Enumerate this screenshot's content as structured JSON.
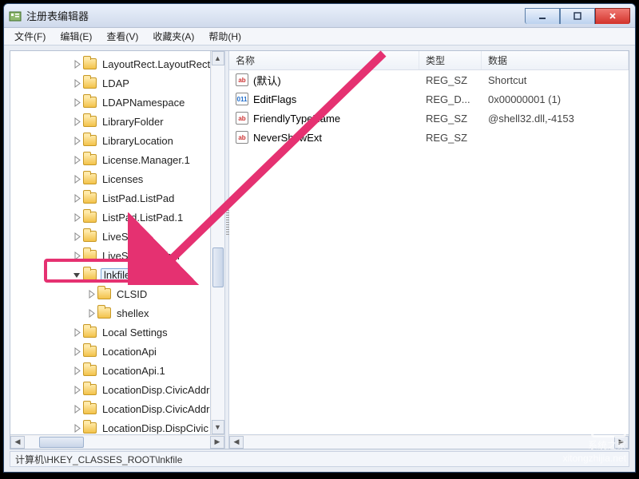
{
  "window": {
    "title": "注册表编辑器"
  },
  "menubar": {
    "items": [
      "文件(F)",
      "编辑(E)",
      "查看(V)",
      "收藏夹(A)",
      "帮助(H)"
    ]
  },
  "tree": {
    "nodes": [
      {
        "indent": 3,
        "expander": "▷",
        "label": "LayoutRect.LayoutRect"
      },
      {
        "indent": 3,
        "expander": "▷",
        "label": "LDAP"
      },
      {
        "indent": 3,
        "expander": "▷",
        "label": "LDAPNamespace"
      },
      {
        "indent": 3,
        "expander": "▷",
        "label": "LibraryFolder"
      },
      {
        "indent": 3,
        "expander": "▷",
        "label": "LibraryLocation"
      },
      {
        "indent": 3,
        "expander": "▷",
        "label": "License.Manager.1"
      },
      {
        "indent": 3,
        "expander": "▷",
        "label": "Licenses"
      },
      {
        "indent": 3,
        "expander": "▷",
        "label": "ListPad.ListPad"
      },
      {
        "indent": 3,
        "expander": "▷",
        "label": "ListPad.ListPad.1"
      },
      {
        "indent": 3,
        "expander": "▷",
        "label": "LiveScript"
      },
      {
        "indent": 3,
        "expander": "▷",
        "label": "LiveScript Author"
      },
      {
        "indent": 3,
        "expander": "◢",
        "label": "lnkfile",
        "selected": true
      },
      {
        "indent": 4,
        "expander": "▷",
        "label": "CLSID"
      },
      {
        "indent": 4,
        "expander": "▷",
        "label": "shellex"
      },
      {
        "indent": 3,
        "expander": "▷",
        "label": "Local Settings"
      },
      {
        "indent": 3,
        "expander": "▷",
        "label": "LocationApi"
      },
      {
        "indent": 3,
        "expander": "▷",
        "label": "LocationApi.1"
      },
      {
        "indent": 3,
        "expander": "▷",
        "label": "LocationDisp.CivicAddr"
      },
      {
        "indent": 3,
        "expander": "▷",
        "label": "LocationDisp.CivicAddr"
      },
      {
        "indent": 3,
        "expander": "▷",
        "label": "LocationDisp.DispCivic"
      }
    ]
  },
  "list": {
    "headers": {
      "name": "名称",
      "type": "类型",
      "data": "数据"
    },
    "rows": [
      {
        "icon": "sz",
        "name": "(默认)",
        "type": "REG_SZ",
        "data": "Shortcut"
      },
      {
        "icon": "bin",
        "name": "EditFlags",
        "type": "REG_D...",
        "data": "0x00000001 (1)"
      },
      {
        "icon": "sz",
        "name": "FriendlyTypeName",
        "type": "REG_SZ",
        "data": "@shell32.dll,-4153"
      },
      {
        "icon": "sz",
        "name": "NeverShowExt",
        "type": "REG_SZ",
        "data": ""
      }
    ]
  },
  "statusbar": {
    "path": "计算机\\HKEY_CLASSES_ROOT\\lnkfile"
  },
  "watermark": {
    "line1": "系统之家",
    "line2": "xitongzhijia.net"
  }
}
